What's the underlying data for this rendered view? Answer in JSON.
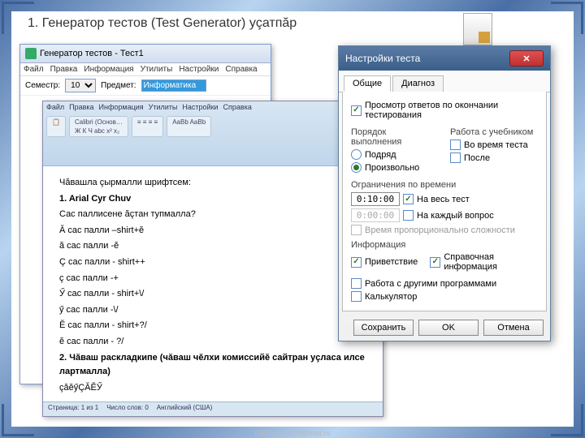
{
  "slide": {
    "title": "1. Генератор тестов (Test Generator) уçатпăр"
  },
  "generator": {
    "title": "Генератор тестов - Тест1",
    "menu": [
      "Файл",
      "Правка",
      "Информация",
      "Утилиты",
      "Настройки",
      "Справка"
    ],
    "semester_label": "Семестр:",
    "semester_value": "10",
    "subject_label": "Предмет:",
    "subject_value": "Информатика"
  },
  "word": {
    "tabs": [
      "Файл",
      "Правка",
      "Информация",
      "Утилиты",
      "Настройки",
      "Справка"
    ],
    "group1": "Calibri (Основ…",
    "heading": "Чăвашла çырмалли шрифтсем:",
    "items": [
      "1. Arial Cyr Chuv",
      "Сас паллисене ăçтан тупмалла?",
      "Ă сас палли –shirt+ĕ",
      "ă сас палли -ĕ",
      "Ç сас палли - shirt++",
      "ç сас палли -+",
      "Ӳ сас палли - shirt+\\/",
      "ӳ сас палли -\\/",
      "Ĕ сас палли - shirt+?/",
      "ĕ сас палли - ?/"
    ],
    "heading2": "2. Чăваш раскладкипе (чăваш чĕлхи комиссийĕ сайтран уçласа илсе лартмалла)",
    "line2": "çăĕӳÇĂĔӲ",
    "status": [
      "Страница: 1 из 1",
      "Число слов: 0",
      "Английский (США)"
    ]
  },
  "settings": {
    "title": "Настройки теста",
    "tabs": {
      "general": "Общие",
      "diagnosis": "Диагноз"
    },
    "preview_label": "Просмотр ответов по окончании тестирования",
    "order_title": "Порядок выполнения",
    "order_seq": "Подряд",
    "order_rand": "Произвольно",
    "textbook_title": "Работа с учебником",
    "textbook_during": "Во время теста",
    "textbook_after": "После",
    "time_title": "Ограничения по времени",
    "time_total_value": "0:10:00",
    "time_total_label": "На весь тест",
    "time_each_value": "0:00:00",
    "time_each_label": "На каждый вопрос",
    "time_prop": "Время пропорционально сложности",
    "info_title": "Информация",
    "info_greet": "Приветствие",
    "info_ref": "Справочная информация",
    "other_prog": "Работа с другими программами",
    "calc": "Калькулятор",
    "btn_save": "Сохранить",
    "btn_ok": "OK",
    "btn_cancel": "Отмена"
  },
  "footer": "FokinaLida.75@mail.ru"
}
